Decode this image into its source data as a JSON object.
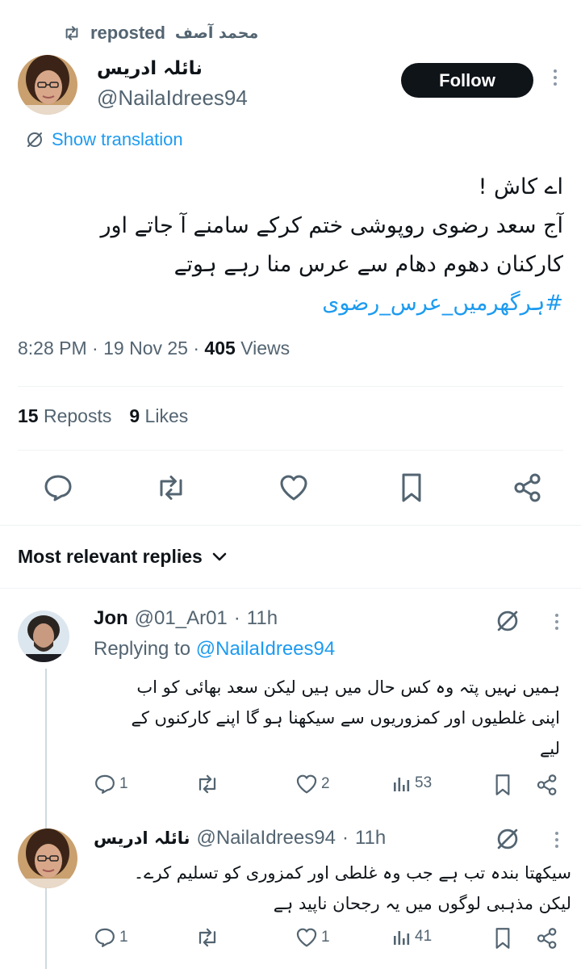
{
  "repost": {
    "label": "reposted",
    "by": "محمد آصف",
    "icon": "repost-icon"
  },
  "author": {
    "name": "نائلہ ادریس",
    "handle": "@NailaIdrees94"
  },
  "follow_label": "Follow",
  "translate_label": "Show translation",
  "tweet": {
    "lines": [
      "اے کاش !",
      "آج سعد رضوی روپوشی ختم کرکے سامنے آ جاتے اور",
      "کارکنان دھوم دھام سے عرس منا رہے ہوتے"
    ],
    "hashtag": "#ہرگھرمیں_عرس_رضوی"
  },
  "meta": {
    "time": "8:28 PM",
    "sep": "·",
    "date": "19 Nov 25",
    "views_count": "405",
    "views_label": "Views"
  },
  "stats": {
    "reposts_count": "15",
    "reposts_label": "Reposts",
    "likes_count": "9",
    "likes_label": "Likes"
  },
  "actions": [
    "reply-icon",
    "repost-icon",
    "like-icon",
    "bookmark-icon",
    "share-icon"
  ],
  "replies_header": {
    "label": "Most relevant replies",
    "icon": "chevron-down-icon"
  },
  "replies": [
    {
      "name": "Jon",
      "handle": "@01_Ar01",
      "time": "11h",
      "replying_prefix": "Replying to",
      "replying_handle": "@NailaIdrees94",
      "lines": [
        "ہمیں نہیں پتہ وہ کس حال میں ہیں لیکن سعد بھائی کو اب",
        "اپنی غلطیوں اور کمزوریوں سے سیکھنا ہو گا اپنے کارکنوں کے",
        "لیے"
      ],
      "replies_count": "1",
      "reposts_count": "",
      "likes_count": "2",
      "views_count": "53"
    },
    {
      "name": "نائلہ ادریس",
      "handle": "@NailaIdrees94",
      "time": "11h",
      "lines": [
        "سیکھتا بندہ تب ہے جب وہ غلطی اور کمزوری کو تسلیم کرے۔",
        "لیکن مذہبی لوگوں میں یہ رجحان ناپید ہے"
      ],
      "replies_count": "1",
      "reposts_count": "",
      "likes_count": "1",
      "views_count": "41"
    }
  ],
  "colors": {
    "text": "#0f1419",
    "secondary": "#536471",
    "accent": "#1d9bf0",
    "follow_bg": "#0f1419",
    "divider": "#eff3f4"
  }
}
